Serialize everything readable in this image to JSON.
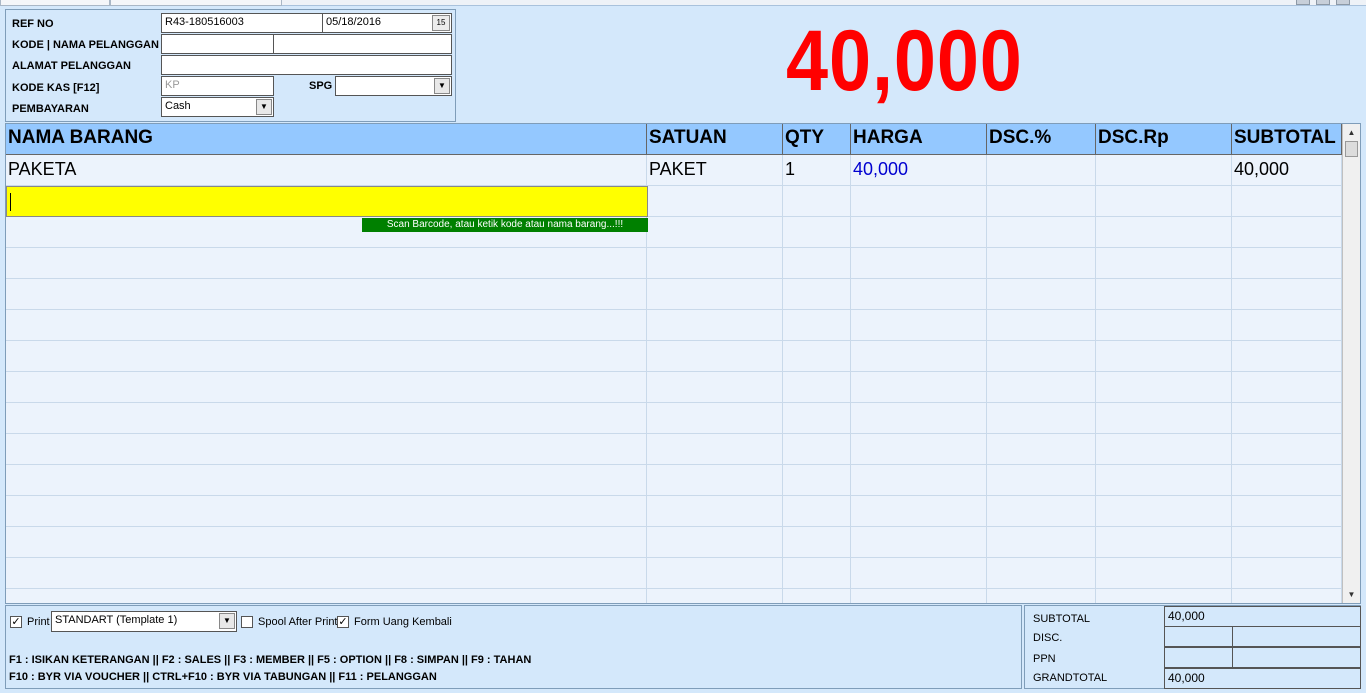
{
  "header": {
    "ref_no_label": "REF NO",
    "ref_no_value": "R43-180516003",
    "date_value": "05/18/2016",
    "calendar_icon": "15",
    "pelanggan_label": "KODE | NAMA PELANGGAN",
    "pelanggan_code": "",
    "pelanggan_name": "",
    "alamat_label": "ALAMAT PELANGGAN",
    "alamat_value": "",
    "kode_kas_label": "KODE KAS [F12]",
    "kode_kas_value": "KP",
    "spg_label": "SPG",
    "spg_value": "",
    "pembayaran_label": "PEMBAYARAN",
    "pembayaran_value": "Cash",
    "dropdown_glyph": "▼"
  },
  "grand_display": "40,000",
  "grid": {
    "columns": [
      "NAMA BARANG",
      "SATUAN",
      "QTY",
      "HARGA",
      "DSC.%",
      "DSC.Rp",
      "SUBTOTAL"
    ],
    "rows": [
      {
        "nama": "PAKETA",
        "satuan": "PAKET",
        "qty": "1",
        "harga": "40,000",
        "dsc_pct": "",
        "dsc_rp": "",
        "subtotal": "40,000"
      }
    ],
    "entry_hint": "Scan Barcode, atau ketik kode atau nama barang...!!!"
  },
  "footer": {
    "print_label": "Print",
    "print_checked": "✓",
    "template_value": "STANDART (Template 1)",
    "spool_label": "Spool After Print",
    "spool_checked": "",
    "uang_kembali_label": "Form Uang Kembali",
    "uang_kembali_checked": "✓",
    "hotkeys_line1": "F1 : ISIKAN KETERANGAN || F2 : SALES || F3 : MEMBER || F5 : OPTION  || F8 : SIMPAN || F9 : TAHAN",
    "hotkeys_line2": "F10 : BYR VIA VOUCHER || CTRL+F10 : BYR VIA TABUNGAN  || F11 : PELANGGAN"
  },
  "summary": {
    "subtotal_label": "SUBTOTAL",
    "subtotal_value": "40,000",
    "disc_label": "DISC.",
    "disc_pct": "",
    "disc_value": "",
    "ppn_label": "PPN",
    "ppn_pct": "",
    "ppn_value": "",
    "grandtotal_label": "GRANDTOTAL",
    "grandtotal_value": "40,000"
  }
}
